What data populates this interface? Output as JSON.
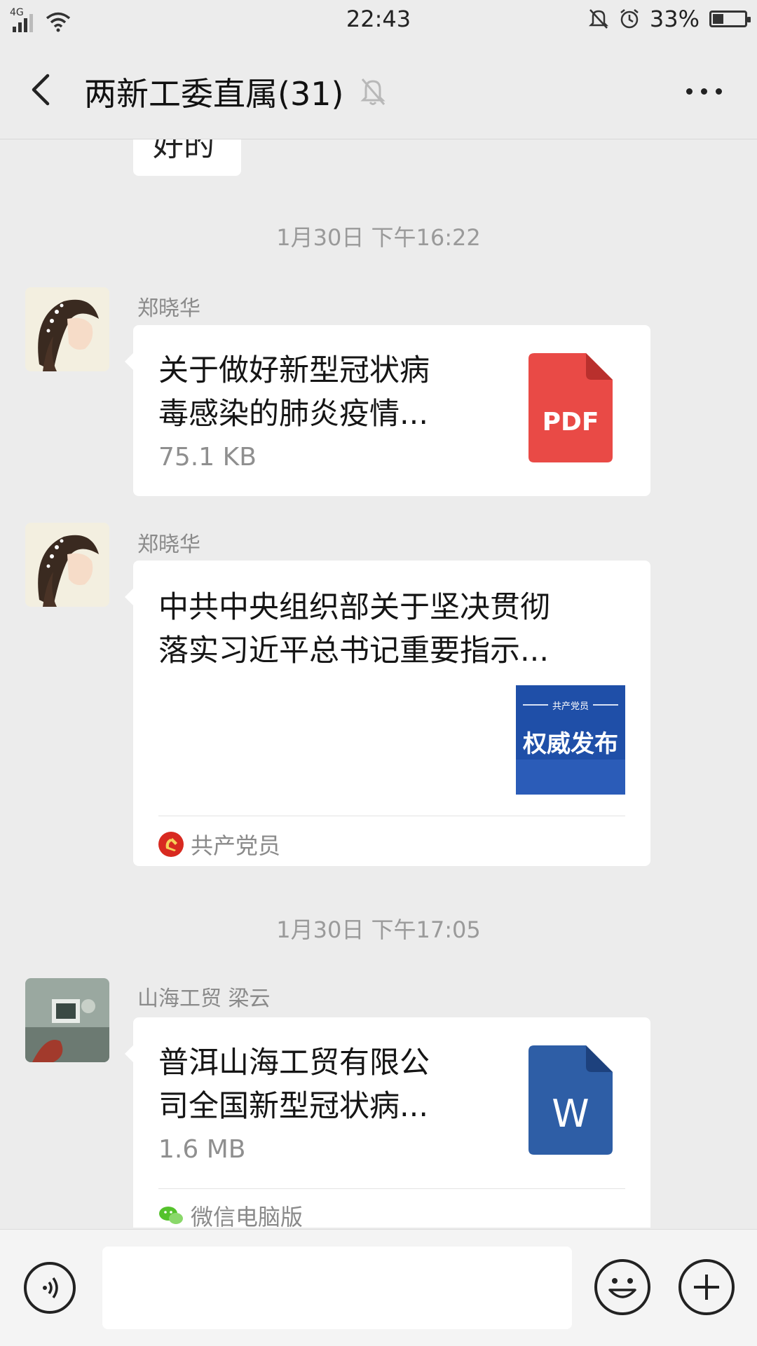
{
  "status_bar": {
    "network": "4G",
    "time": "22:43",
    "battery_percent": "33%",
    "battery_level": 0.33,
    "icons": [
      "signal-icon",
      "wifi-icon",
      "mute-icon",
      "alarm-icon",
      "battery-icon"
    ]
  },
  "header": {
    "title": "两新工委直属(31)",
    "back_icon": "back-icon",
    "mute_icon": "mute-icon",
    "more_icon": "more-icon"
  },
  "messages": {
    "partial_text": "好的",
    "timestamp_1": "1月30日 下午16:22",
    "msg1": {
      "sender": "郑晓华",
      "title_line1": "关于做好新型冠状病",
      "title_line2": "毒感染的肺炎疫情...",
      "size": "75.1 KB",
      "file_type": "PDF",
      "file_color": "#e94a46"
    },
    "msg2": {
      "sender": "郑晓华",
      "title_line1": "中共中央组织部关于坚决贯彻",
      "title_line2": "落实习近平总书记重要指示...",
      "thumb_top": "共产党员",
      "thumb_main": "权威发布",
      "source": "共产党员"
    },
    "timestamp_2": "1月30日 下午17:05",
    "msg3": {
      "sender": "山海工贸  梁云",
      "title_line1": "普洱山海工贸有限公",
      "title_line2": "司全国新型冠状病...",
      "size": "1.6 MB",
      "file_type": "W",
      "file_color": "#2e5ea6",
      "source": "微信电脑版"
    }
  },
  "input_bar": {
    "voice_icon": "voice-icon",
    "emoji_icon": "emoji-icon",
    "plus_icon": "plus-icon"
  },
  "colors": {
    "background": "#ececec",
    "pdf_red": "#e94a46",
    "word_blue": "#2e5ea6",
    "thumb_blue": "#1f4fa8"
  }
}
